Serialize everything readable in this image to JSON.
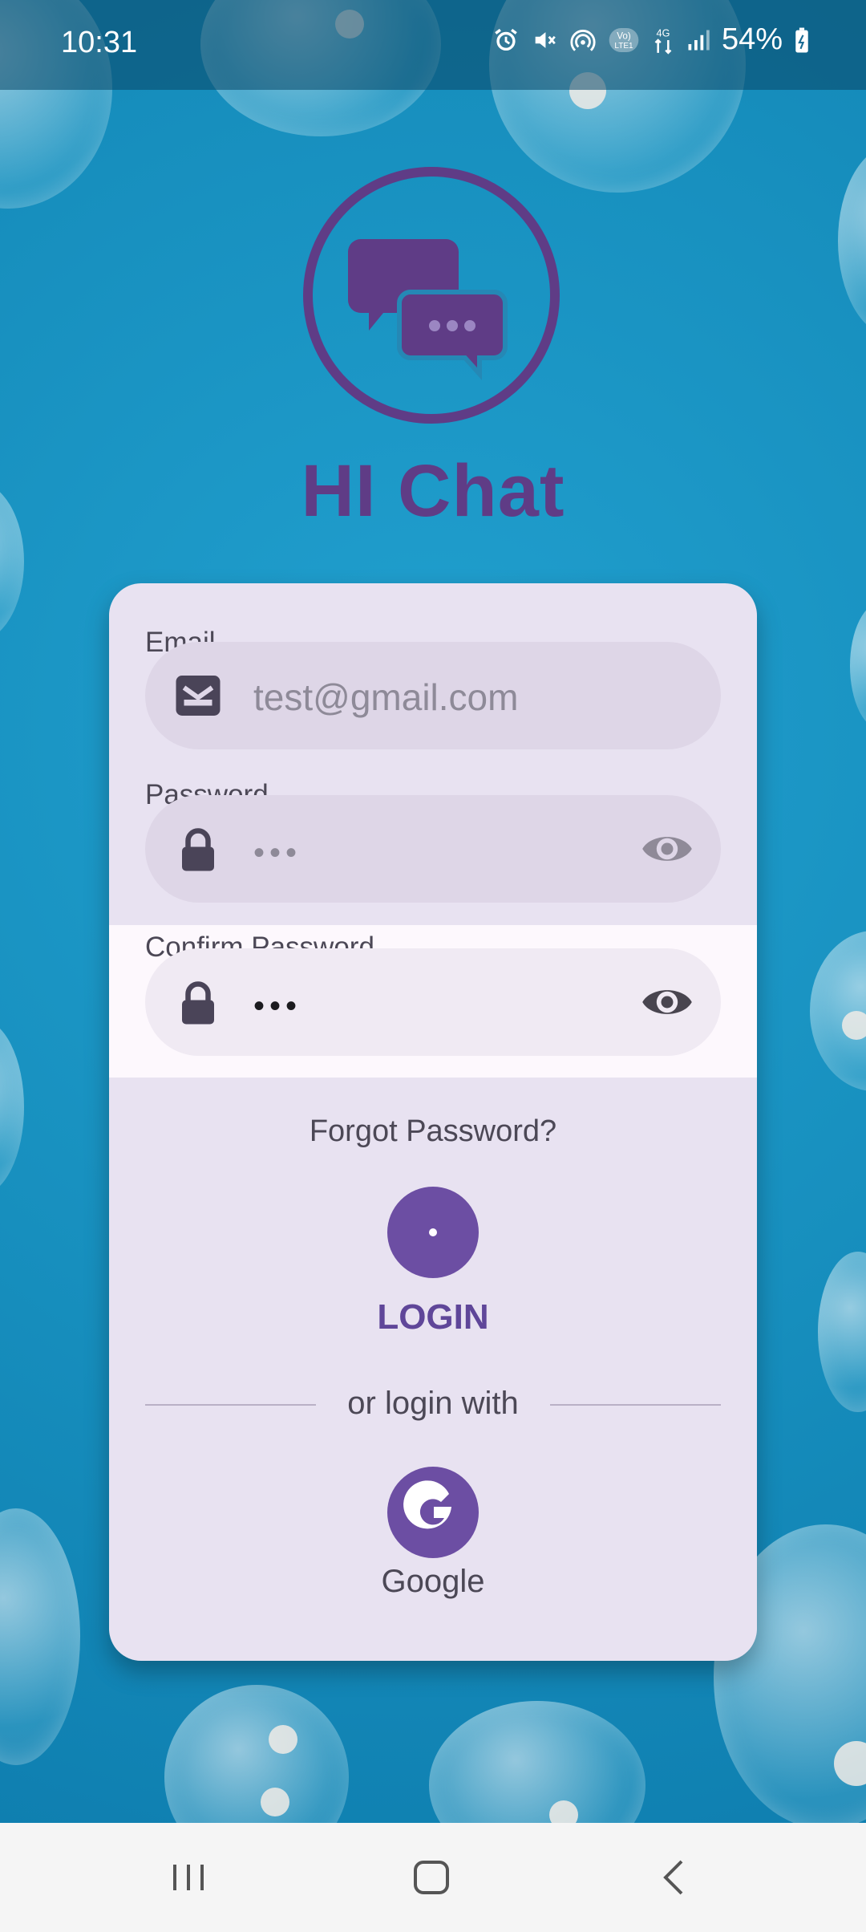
{
  "status_bar": {
    "time": "10:31",
    "battery": "54%",
    "network": "4G",
    "icons": [
      "alarm-icon",
      "mute-icon",
      "hotspot-icon",
      "volte-icon",
      "data-arrows-icon",
      "signal-icon",
      "battery-icon"
    ]
  },
  "app": {
    "title": "HI Chat",
    "logo_icon": "chat-bubbles-icon",
    "brand_color": "#5f3c86"
  },
  "form": {
    "email": {
      "label": "Email",
      "placeholder": "test@gmail.com",
      "value": "",
      "icon": "envelope-icon"
    },
    "password": {
      "label": "Password",
      "value_masked": "•••",
      "icon": "lock-icon",
      "toggle_icon": "eye-icon"
    },
    "confirm_password": {
      "label": "Confirm Password",
      "value_masked": "•••",
      "icon": "lock-icon",
      "toggle_icon": "eye-icon"
    },
    "forgot_password": "Forgot Password?",
    "login_label": "LOGIN",
    "divider_text": "or login with",
    "google_label": "Google",
    "accent_color": "#6c4ea3"
  },
  "nav_bar": {
    "buttons": [
      "recents-icon",
      "home-icon",
      "back-icon"
    ]
  }
}
